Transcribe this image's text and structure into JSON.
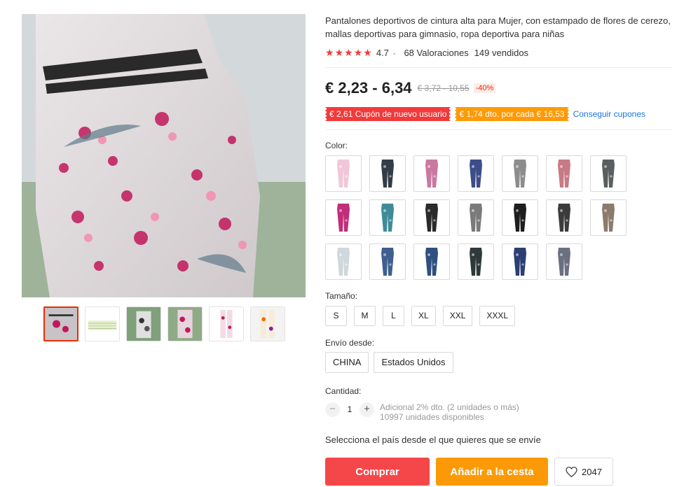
{
  "product": {
    "title": "Pantalones deportivos de cintura alta para Mujer, con estampado de flores de cerezo, mallas deportivas para gimnasio, ropa deportiva para niñas",
    "rating": "4.7",
    "reviews": "68 Valoraciones",
    "sold": "149 vendidos"
  },
  "price": {
    "current": "€ 2,23 - 6,34",
    "original": "€ 3,72 - 10,55",
    "discount": "-40%"
  },
  "coupons": {
    "new_user": "€ 2,61 Cupón de nuevo usuario",
    "per_spend": "€ 1,74 dto. por cada € 16,53",
    "get_link": "Conseguir cupones"
  },
  "color": {
    "label": "Color:",
    "swatch_colors": [
      "#f1c6d8",
      "#333d47",
      "#c9789f",
      "#3d4d8a",
      "#8d8d8d",
      "#c77a86",
      "#5a5f5f",
      "#c12e7a",
      "#3f8c99",
      "#2a2a2a",
      "#7a7a7a",
      "#1e1e1e",
      "#3b3b3b",
      "#8c7b6b",
      "#cfd8dc",
      "#3f5f8f",
      "#2f4f7f",
      "#2e3a3a",
      "#2b3f73",
      "#6a7080"
    ]
  },
  "size": {
    "label": "Tamaño:",
    "options": [
      "S",
      "M",
      "L",
      "XL",
      "XXL",
      "XXXL"
    ]
  },
  "shipping": {
    "label": "Envío desde:",
    "options": [
      "CHINA",
      "Estados Unidos"
    ],
    "note": "Selecciona el país desde el que quieres que se envíe"
  },
  "quantity": {
    "label": "Cantidad:",
    "value": "1",
    "minus": "−",
    "plus": "+",
    "discount_note": "Adicional 2% dto. (2 unidades o más)",
    "available": "10997 unidades disponibles"
  },
  "actions": {
    "buy": "Comprar",
    "cart": "Añadir a la cesta",
    "wishlist_count": "2047"
  },
  "theme": {
    "accent": "#f5474a",
    "orange": "#fb9a06",
    "link": "#1a73e8",
    "star": "#f23a3a"
  }
}
